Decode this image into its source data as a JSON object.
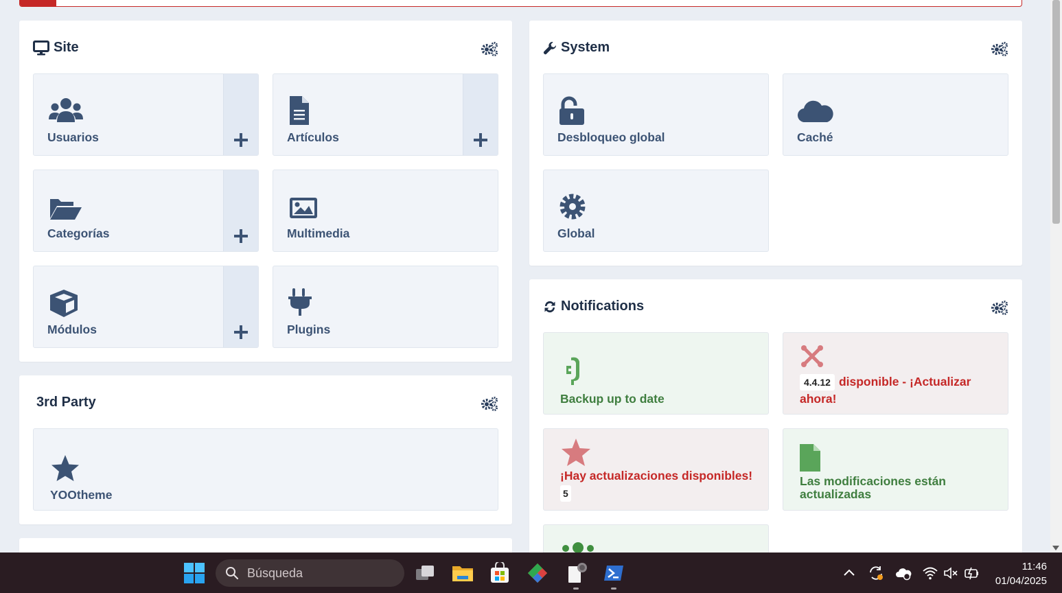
{
  "site": {
    "title": "Site",
    "tiles": [
      {
        "label": "Usuarios",
        "icon": "users-icon",
        "has_add": true
      },
      {
        "label": "Artículos",
        "icon": "file-icon",
        "has_add": true
      },
      {
        "label": "Categorías",
        "icon": "folder-open-icon",
        "has_add": true
      },
      {
        "label": "Multimedia",
        "icon": "image-icon",
        "has_add": false
      },
      {
        "label": "Módulos",
        "icon": "cube-icon",
        "has_add": true
      },
      {
        "label": "Plugins",
        "icon": "plug-icon",
        "has_add": false
      }
    ]
  },
  "third_party": {
    "title": "3rd Party",
    "tiles": [
      {
        "label": "YOOtheme",
        "icon": "star-icon"
      }
    ]
  },
  "system": {
    "title": "System",
    "tiles": [
      {
        "label": "Desbloqueo global",
        "icon": "unlock-icon"
      },
      {
        "label": "Caché",
        "icon": "cloud-icon"
      },
      {
        "label": "Global",
        "icon": "gear-icon"
      }
    ]
  },
  "notifications": {
    "title": "Notifications",
    "items": [
      {
        "text": "Backup up to date",
        "status": "green"
      },
      {
        "version_badge": "4.4.12",
        "text_line1": "disponible - ¡Actualizar",
        "text_line2": "ahora!",
        "status": "red"
      },
      {
        "text": "¡Hay actualizaciones disponibles!",
        "count_badge": "5",
        "status": "red"
      },
      {
        "text_line1": "Las modificaciones están",
        "text_line2": "actualizadas",
        "status": "green"
      }
    ]
  },
  "taskbar": {
    "search_placeholder": "Búsqueda",
    "time": "11:46",
    "date": "01/04/2025"
  },
  "colors": {
    "primary": "#3c5374",
    "heading": "#1f2f47",
    "danger": "#c52827",
    "success": "#3f7e3f",
    "background": "#eaeef4"
  }
}
